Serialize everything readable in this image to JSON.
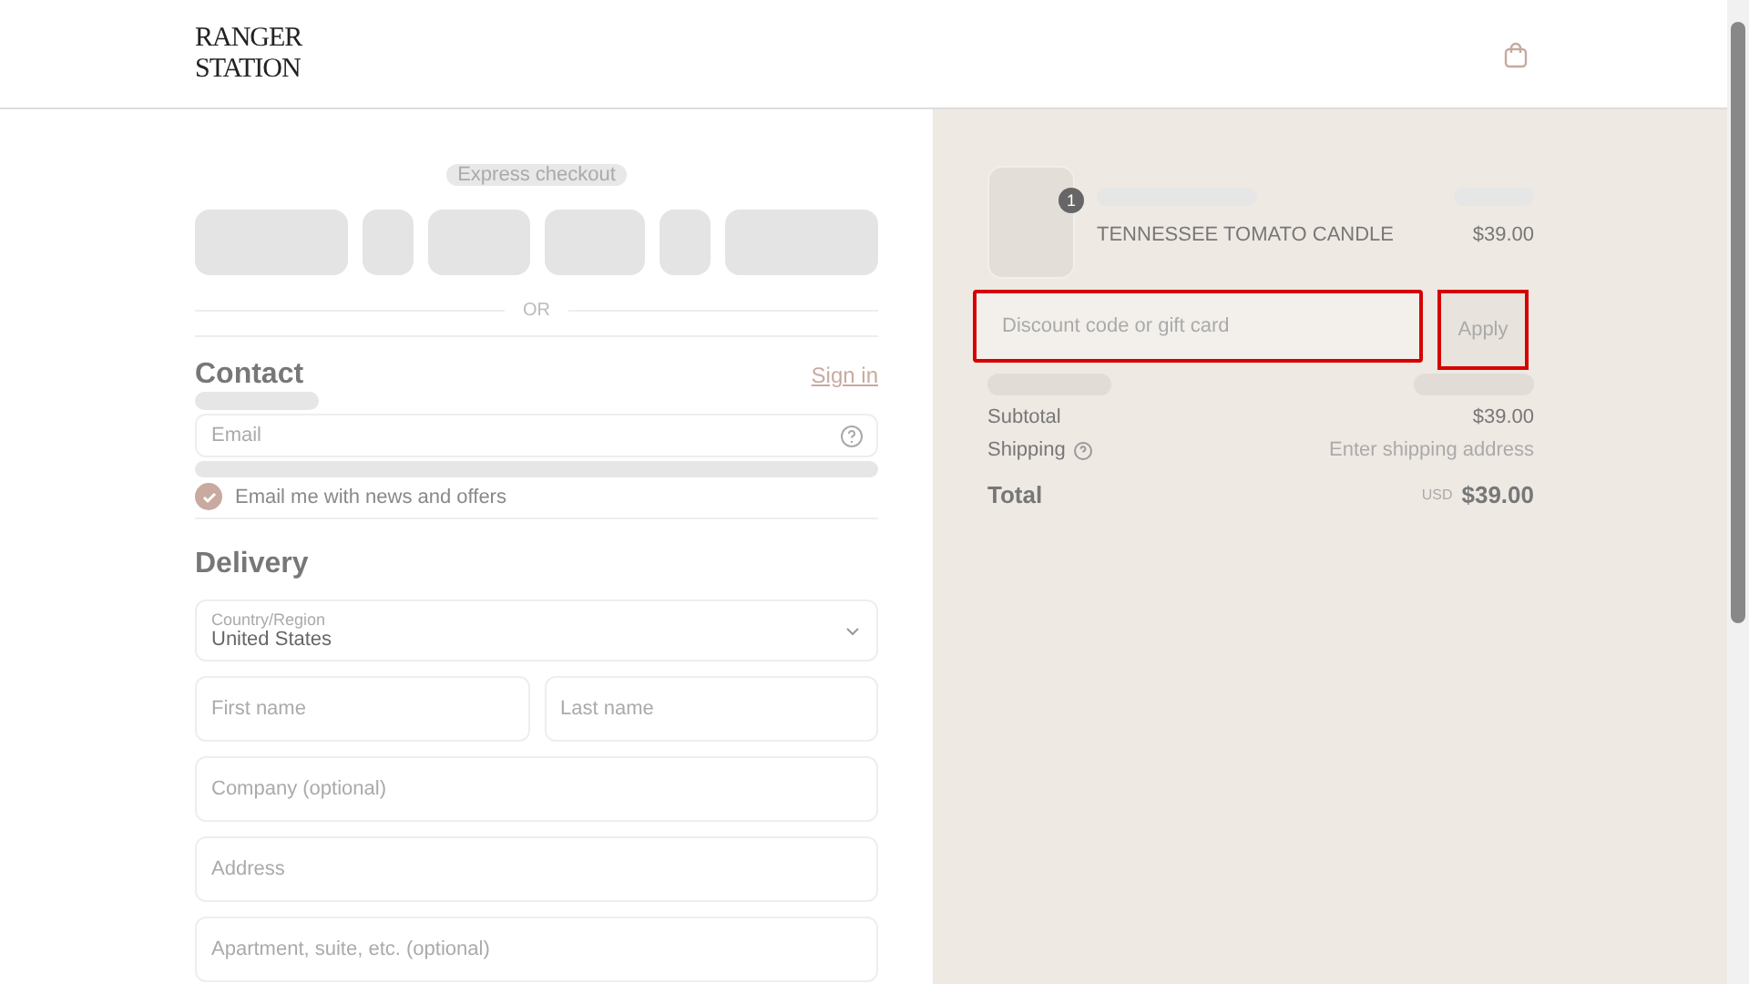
{
  "header": {
    "logo_lines": [
      "RANGER",
      "STATION"
    ]
  },
  "express": {
    "title": "Express checkout",
    "divider": "OR"
  },
  "contact": {
    "title": "Contact",
    "link": "Sign in",
    "email": {
      "placeholder": "Email"
    },
    "newsletter": {
      "label": "Email me with news and offers",
      "checked": true
    }
  },
  "delivery": {
    "title": "Delivery",
    "country": {
      "label": "Country/Region",
      "value": "United States"
    },
    "fields": [
      {
        "placeholder": "First name",
        "half": true
      },
      {
        "placeholder": "Last name",
        "half": true
      },
      {
        "placeholder": "Company (optional)",
        "half": false
      },
      {
        "placeholder": "Address",
        "half": false
      },
      {
        "placeholder": "Apartment, suite, etc. (optional)",
        "half": false
      }
    ]
  },
  "summary": {
    "item": {
      "quantity": "1",
      "name": "TENNESSEE TOMATO CANDLE",
      "price": "$39.00"
    },
    "discount": {
      "placeholder": "Discount code or gift card",
      "highlighted": true
    },
    "apply": {
      "label": "Apply",
      "highlighted": true
    },
    "lines": [
      {
        "label": "Subtotal",
        "value": "$39.00",
        "help": false
      },
      {
        "label": "Shipping",
        "value": "Enter shipping address",
        "help": true
      }
    ],
    "total": {
      "label": "Total",
      "currency": "USD",
      "value": "$39.00"
    }
  }
}
